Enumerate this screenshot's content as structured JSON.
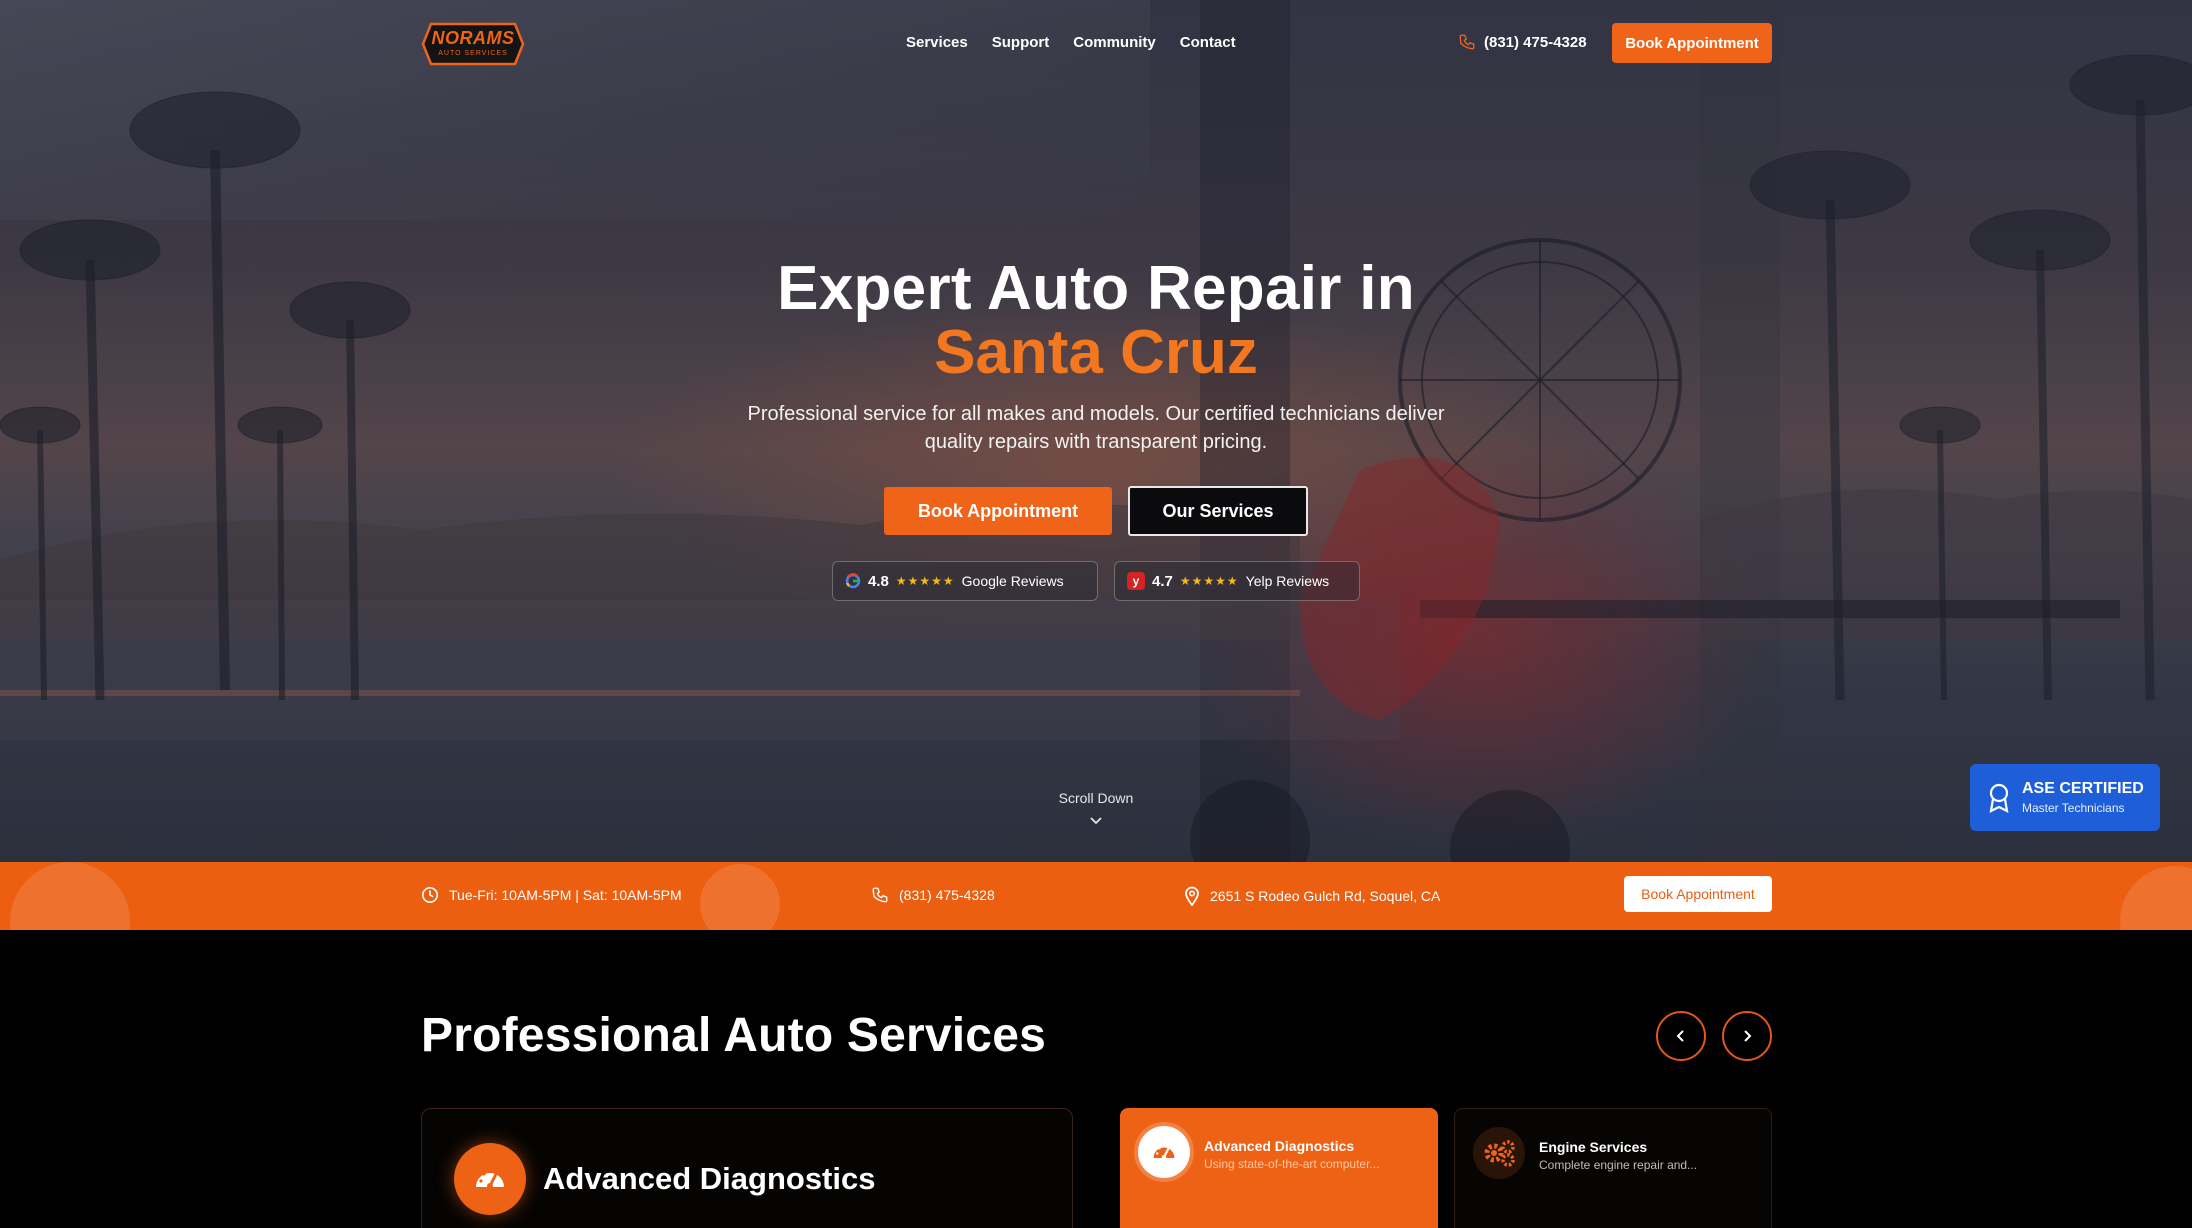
{
  "brand": {
    "logo_main": "NORAMS",
    "logo_sub": "AUTO SERVICES",
    "accent": "#ef6418",
    "badge_blue": "#1e5fd9"
  },
  "nav": {
    "links": [
      "Services",
      "Support",
      "Community",
      "Contact"
    ],
    "phone": "(831) 475-4328",
    "cta": "Book Appointment"
  },
  "hero": {
    "title_line1": "Expert Auto Repair in",
    "title_line2": "Santa Cruz",
    "subtitle": "Professional service for all makes and models. Our certified technicians deliver quality repairs with transparent pricing.",
    "primary_btn": "Book Appointment",
    "secondary_btn": "Our Services",
    "reviews": [
      {
        "icon": "google-icon",
        "score": "4.8",
        "stars": "★★★★★",
        "label": "Google Reviews"
      },
      {
        "icon": "yelp-icon",
        "score": "4.7",
        "stars": "★★★★★",
        "label": "Yelp Reviews"
      }
    ],
    "scroll_label": "Scroll Down"
  },
  "certification": {
    "title": "ASE CERTIFIED",
    "subtitle": "Master Technicians"
  },
  "info_bar": {
    "hours": "Tue-Fri: 10AM-5PM | Sat: 10AM-5PM",
    "phone": "(831) 475-4328",
    "address": "2651 S Rodeo Gulch Rd, Soquel, CA",
    "cta": "Book Appointment"
  },
  "services": {
    "title": "Professional Auto Services",
    "featured": {
      "title": "Advanced Diagnostics",
      "icon": "speedometer-icon"
    },
    "cards": [
      {
        "title": "Advanced Diagnostics",
        "desc": "Using state-of-the-art computer...",
        "icon": "speedometer-icon",
        "active": true
      },
      {
        "title": "Engine Services",
        "desc": "Complete engine repair and...",
        "icon": "gears-icon",
        "active": false
      }
    ]
  }
}
